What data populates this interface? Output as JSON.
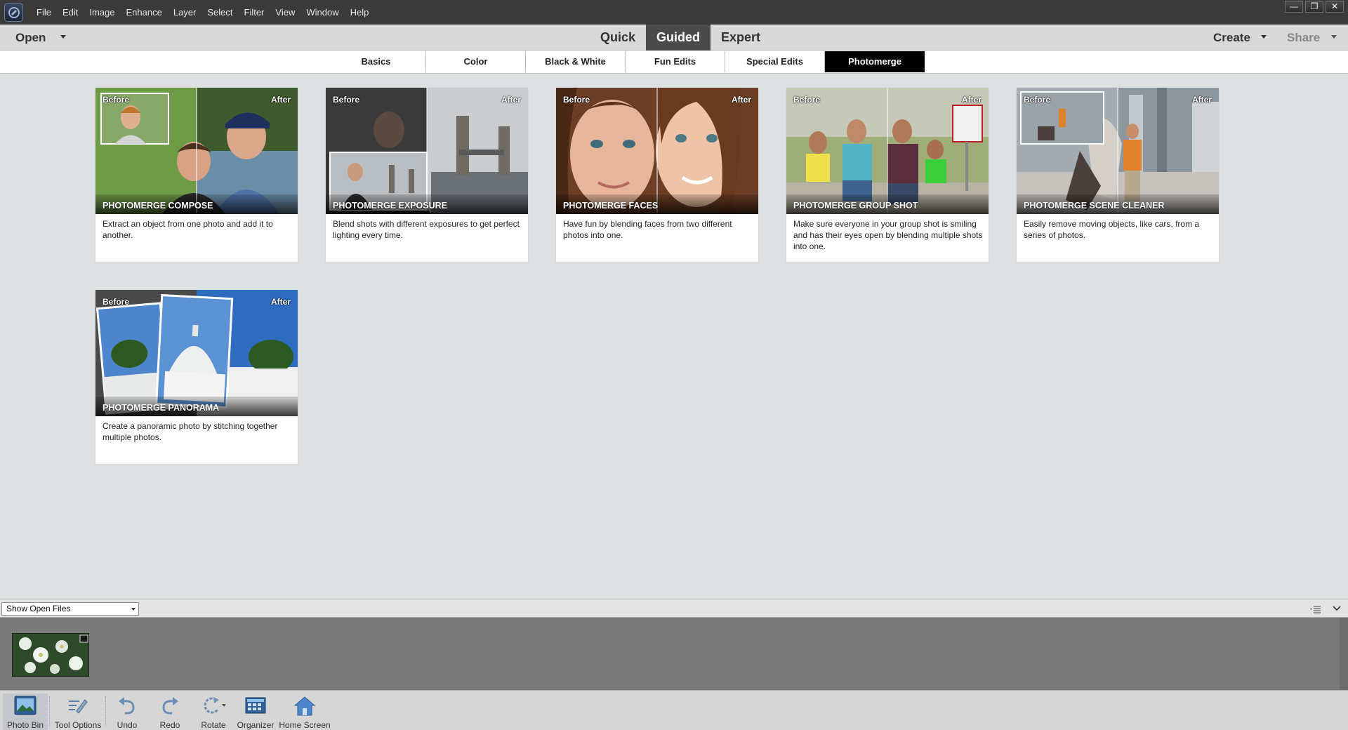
{
  "menubar": {
    "items": [
      "File",
      "Edit",
      "Image",
      "Enhance",
      "Layer",
      "Select",
      "Filter",
      "View",
      "Window",
      "Help"
    ],
    "window_buttons": {
      "minimize": "—",
      "restore": "❐",
      "close": "✕"
    }
  },
  "modebar": {
    "open_label": "Open",
    "modes": [
      {
        "label": "Quick",
        "active": false
      },
      {
        "label": "Guided",
        "active": true
      },
      {
        "label": "Expert",
        "active": false
      }
    ],
    "create_label": "Create",
    "share_label": "Share"
  },
  "categories": {
    "tabs": [
      "Basics",
      "Color",
      "Black & White",
      "Fun Edits",
      "Special Edits",
      "Photomerge"
    ],
    "active": "Photomerge"
  },
  "cards": [
    {
      "title": "PHOTOMERGE COMPOSE",
      "before": "Before",
      "after": "After",
      "description": "Extract an object from one photo and add it to another."
    },
    {
      "title": "PHOTOMERGE EXPOSURE",
      "before": "Before",
      "after": "After",
      "description": "Blend shots with different exposures to get perfect lighting every time."
    },
    {
      "title": "PHOTOMERGE FACES",
      "before": "Before",
      "after": "After",
      "description": "Have fun by blending faces from two different photos into one."
    },
    {
      "title": "PHOTOMERGE GROUP SHOT",
      "before": "Before",
      "after": "After",
      "description": "Make sure everyone in your group shot is smiling and has their eyes open by blending multiple shots into one."
    },
    {
      "title": "PHOTOMERGE SCENE CLEANER",
      "before": "Before",
      "after": "After",
      "description": "Easily remove moving objects, like cars, from a series of photos."
    },
    {
      "title": "PHOTOMERGE PANORAMA",
      "before": "Before",
      "after": "After",
      "description": "Create a panoramic photo by stitching together multiple photos."
    }
  ],
  "photobin": {
    "select_value": "Show Open Files"
  },
  "toolbar": {
    "photo_bin": "Photo Bin",
    "tool_options": "Tool Options",
    "undo": "Undo",
    "redo": "Redo",
    "rotate": "Rotate",
    "organizer": "Organizer",
    "home_screen": "Home Screen"
  }
}
